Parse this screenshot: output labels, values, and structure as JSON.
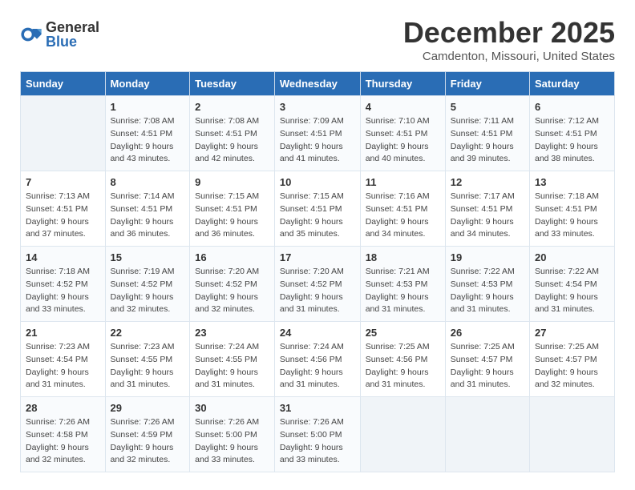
{
  "logo": {
    "general": "General",
    "blue": "Blue"
  },
  "title": {
    "month": "December 2025",
    "location": "Camdenton, Missouri, United States"
  },
  "weekdays": [
    "Sunday",
    "Monday",
    "Tuesday",
    "Wednesday",
    "Thursday",
    "Friday",
    "Saturday"
  ],
  "weeks": [
    [
      {
        "day": "",
        "empty": true
      },
      {
        "day": "1",
        "sunrise": "7:08 AM",
        "sunset": "4:51 PM",
        "daylight": "9 hours and 43 minutes."
      },
      {
        "day": "2",
        "sunrise": "7:08 AM",
        "sunset": "4:51 PM",
        "daylight": "9 hours and 42 minutes."
      },
      {
        "day": "3",
        "sunrise": "7:09 AM",
        "sunset": "4:51 PM",
        "daylight": "9 hours and 41 minutes."
      },
      {
        "day": "4",
        "sunrise": "7:10 AM",
        "sunset": "4:51 PM",
        "daylight": "9 hours and 40 minutes."
      },
      {
        "day": "5",
        "sunrise": "7:11 AM",
        "sunset": "4:51 PM",
        "daylight": "9 hours and 39 minutes."
      },
      {
        "day": "6",
        "sunrise": "7:12 AM",
        "sunset": "4:51 PM",
        "daylight": "9 hours and 38 minutes."
      }
    ],
    [
      {
        "day": "7",
        "sunrise": "7:13 AM",
        "sunset": "4:51 PM",
        "daylight": "9 hours and 37 minutes."
      },
      {
        "day": "8",
        "sunrise": "7:14 AM",
        "sunset": "4:51 PM",
        "daylight": "9 hours and 36 minutes."
      },
      {
        "day": "9",
        "sunrise": "7:15 AM",
        "sunset": "4:51 PM",
        "daylight": "9 hours and 36 minutes."
      },
      {
        "day": "10",
        "sunrise": "7:15 AM",
        "sunset": "4:51 PM",
        "daylight": "9 hours and 35 minutes."
      },
      {
        "day": "11",
        "sunrise": "7:16 AM",
        "sunset": "4:51 PM",
        "daylight": "9 hours and 34 minutes."
      },
      {
        "day": "12",
        "sunrise": "7:17 AM",
        "sunset": "4:51 PM",
        "daylight": "9 hours and 34 minutes."
      },
      {
        "day": "13",
        "sunrise": "7:18 AM",
        "sunset": "4:51 PM",
        "daylight": "9 hours and 33 minutes."
      }
    ],
    [
      {
        "day": "14",
        "sunrise": "7:18 AM",
        "sunset": "4:52 PM",
        "daylight": "9 hours and 33 minutes."
      },
      {
        "day": "15",
        "sunrise": "7:19 AM",
        "sunset": "4:52 PM",
        "daylight": "9 hours and 32 minutes."
      },
      {
        "day": "16",
        "sunrise": "7:20 AM",
        "sunset": "4:52 PM",
        "daylight": "9 hours and 32 minutes."
      },
      {
        "day": "17",
        "sunrise": "7:20 AM",
        "sunset": "4:52 PM",
        "daylight": "9 hours and 31 minutes."
      },
      {
        "day": "18",
        "sunrise": "7:21 AM",
        "sunset": "4:53 PM",
        "daylight": "9 hours and 31 minutes."
      },
      {
        "day": "19",
        "sunrise": "7:22 AM",
        "sunset": "4:53 PM",
        "daylight": "9 hours and 31 minutes."
      },
      {
        "day": "20",
        "sunrise": "7:22 AM",
        "sunset": "4:54 PM",
        "daylight": "9 hours and 31 minutes."
      }
    ],
    [
      {
        "day": "21",
        "sunrise": "7:23 AM",
        "sunset": "4:54 PM",
        "daylight": "9 hours and 31 minutes."
      },
      {
        "day": "22",
        "sunrise": "7:23 AM",
        "sunset": "4:55 PM",
        "daylight": "9 hours and 31 minutes."
      },
      {
        "day": "23",
        "sunrise": "7:24 AM",
        "sunset": "4:55 PM",
        "daylight": "9 hours and 31 minutes."
      },
      {
        "day": "24",
        "sunrise": "7:24 AM",
        "sunset": "4:56 PM",
        "daylight": "9 hours and 31 minutes."
      },
      {
        "day": "25",
        "sunrise": "7:25 AM",
        "sunset": "4:56 PM",
        "daylight": "9 hours and 31 minutes."
      },
      {
        "day": "26",
        "sunrise": "7:25 AM",
        "sunset": "4:57 PM",
        "daylight": "9 hours and 31 minutes."
      },
      {
        "day": "27",
        "sunrise": "7:25 AM",
        "sunset": "4:57 PM",
        "daylight": "9 hours and 32 minutes."
      }
    ],
    [
      {
        "day": "28",
        "sunrise": "7:26 AM",
        "sunset": "4:58 PM",
        "daylight": "9 hours and 32 minutes."
      },
      {
        "day": "29",
        "sunrise": "7:26 AM",
        "sunset": "4:59 PM",
        "daylight": "9 hours and 32 minutes."
      },
      {
        "day": "30",
        "sunrise": "7:26 AM",
        "sunset": "5:00 PM",
        "daylight": "9 hours and 33 minutes."
      },
      {
        "day": "31",
        "sunrise": "7:26 AM",
        "sunset": "5:00 PM",
        "daylight": "9 hours and 33 minutes."
      },
      {
        "day": "",
        "empty": true
      },
      {
        "day": "",
        "empty": true
      },
      {
        "day": "",
        "empty": true
      }
    ]
  ]
}
